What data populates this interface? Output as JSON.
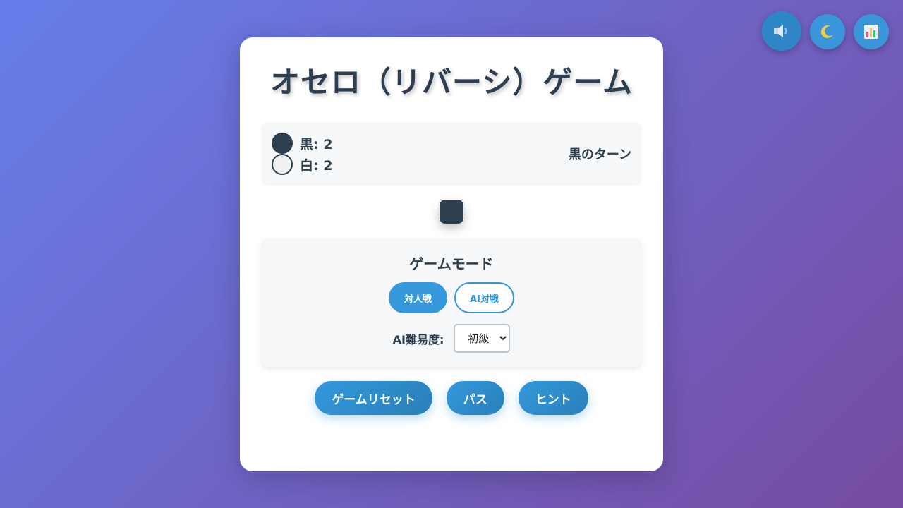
{
  "title": "オセロ（リバーシ）ゲーム",
  "top_controls": [
    {
      "icon": "speaker-icon"
    },
    {
      "icon": "moon-icon"
    },
    {
      "icon": "stats-icon"
    }
  ],
  "score": {
    "black_label": "黒: 2",
    "white_label": "白: 2",
    "turn": "黒のターン"
  },
  "mode": {
    "title": "ゲームモード",
    "pvp": "対人戦",
    "ai": "AI対戦",
    "difficulty_label": "AI難易度:",
    "difficulty_value": "初級"
  },
  "actions": {
    "reset": "ゲームリセット",
    "pass": "パス",
    "hint": "ヒント"
  },
  "colors": {
    "accent": "#3498db",
    "text": "#2c3e50",
    "bg_start": "#667eea",
    "bg_end": "#764ba2"
  }
}
